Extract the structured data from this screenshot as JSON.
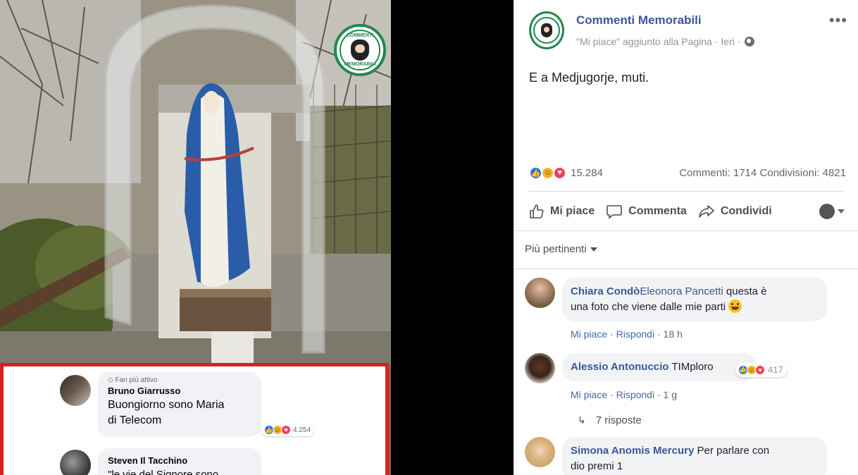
{
  "photo": {
    "watermark_top": "COMMENTI",
    "watermark_bottom": "MEMORABILI"
  },
  "embedded_comments": [
    {
      "badge_icon": "diamond-icon",
      "badge": "Fan più attivo",
      "name": "Bruno Giarrusso",
      "text_line1": "Buongiorno sono Maria",
      "text_line2": "di Telecom",
      "reaction_count": "4.254"
    },
    {
      "name": "Steven Il Tacchino",
      "text_line1": "\"le vie del Signore sono"
    }
  ],
  "post": {
    "page_name": "Commenti Memorabili",
    "meta": "\"Mi piace\" aggiunto alla Pagina · Ieri ·",
    "more_icon": "more-icon",
    "text": "E a Medjugorje, muti.",
    "reaction_count": "15.284",
    "comments_shares": "Commenti: 1714  Condivisioni: 4821",
    "actions": {
      "like": "Mi piace",
      "comment": "Commenta",
      "share": "Condividi"
    },
    "sort_label": "Più pertinenti"
  },
  "comments": [
    {
      "name": "Chiara Condò",
      "tag": "Eleonora Pancetti",
      "text_a": " questa è",
      "text_b": "una foto che viene dalle mie parti",
      "like": "Mi piace",
      "reply": "Rispondi",
      "time": "18 h"
    },
    {
      "name": "Alessio Antonuccio",
      "text": " TIMploro",
      "reaction_count": "417",
      "like": "Mi piace",
      "reply": "Rispondi",
      "time": "1 g",
      "replies": "7 risposte"
    },
    {
      "name": "Simona Anomis Mercury",
      "text_a": " Per parlare con",
      "text_b": "dio premi 1"
    }
  ],
  "colors": {
    "link_blue": "#385898",
    "like_blue": "#1877f2",
    "haha_yellow": "#f7b125",
    "love_red": "#f33e58",
    "frame_red": "#d8221f",
    "brand_green": "#1f8a4c"
  }
}
